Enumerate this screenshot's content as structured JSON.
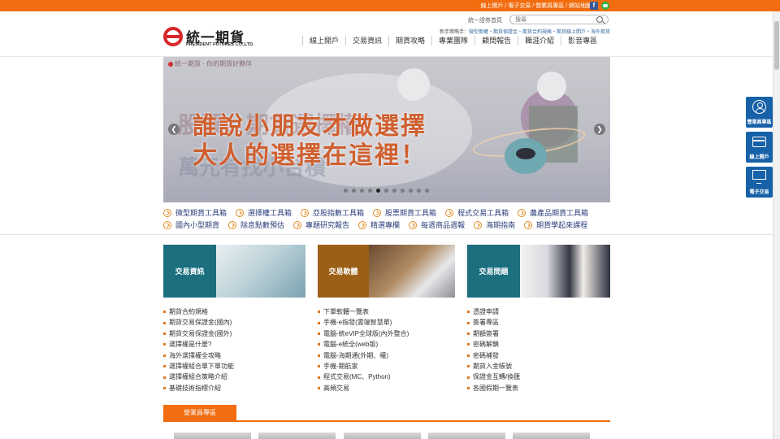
{
  "topbar": {
    "links": "線上開戶 / 電子交易 / 營業員專區 / 網站地圖",
    "facebook_glyph": "f"
  },
  "header": {
    "logo_name": "統一期貨",
    "logo_en": "PRESIDENT FUTURES CO.,LTD.",
    "home_link": "統一證券首頁",
    "search_placeholder": "搜尋",
    "newbie_label": "新手策略手：",
    "newbie_links": "微型期權・期貨保證金・期貨合約規格・期貨線上開戶・海外期貨",
    "nav": [
      "線上開戶",
      "交易資訊",
      "期貨攻略",
      "專業團隊",
      "顧問報告",
      "職涯介紹",
      "影音專區"
    ]
  },
  "banner": {
    "brand": "統一期貨 · 你的期貨好夥伴",
    "bg_text": "股票、期貨選擇權？",
    "bg_text2": "萬元有找小台積",
    "headline": "誰說小朋友才做選擇",
    "subline": "大人的選擇在這裡！",
    "prev": "❮",
    "next": "❯",
    "slides": 11,
    "active_slide": 4
  },
  "quick_links": {
    "row1": [
      "微型期貨工具箱",
      "選擇權工具箱",
      "亞股指數工具箱",
      "股票期貨工具箱",
      "程式交易工具箱",
      "農產品期貨工具箱"
    ],
    "row2": [
      "國內小型期貨",
      "除息點數預估",
      "專題研究報告",
      "精選專欄",
      "每週商品週報",
      "海期指南",
      "期貨學起來課程"
    ]
  },
  "cards": {
    "trading_info": {
      "label": "交易資訊",
      "items": [
        "期貨合約規格",
        "期貨交易保證金(國內)",
        "期貨交易保證金(國外)",
        "選擇權是什麼?",
        "海外選擇權全攻略",
        "選擇權組合單下單功能",
        "選擇權組合策略介紹",
        "基礎技術指標介紹"
      ]
    },
    "trading_software": {
      "label": "交易軟體",
      "items": [
        "下單軟體一覽表",
        "手機-e指發(雲端智慧單)",
        "電腦-統eVIP全球版(內外整合)",
        "電腦-e統全(web版)",
        "電腦-海期通(外期、權)",
        "手機-期航家",
        "程式交易(MC、Python)",
        "高頻交易"
      ]
    },
    "trading_questions": {
      "label": "交易問題",
      "items": [
        "憑證申請",
        "簽署專區",
        "期額簽署",
        "密碼解鎖",
        "密碼補發",
        "期貨入金帳號",
        "保證金互轉/換匯",
        "各國假期一覽表"
      ]
    }
  },
  "sales": {
    "tab_label": "營業員專區"
  },
  "side": {
    "broker": "營業員專區",
    "open_account": "線上開戶",
    "e_trading": "電子交易"
  },
  "colors": {
    "brand_orange": "#f26d0f",
    "teal": "#1b6f7f",
    "brown": "#9b6016",
    "side_blue": "#1761a8",
    "link_blue": "#2a3e7a"
  }
}
